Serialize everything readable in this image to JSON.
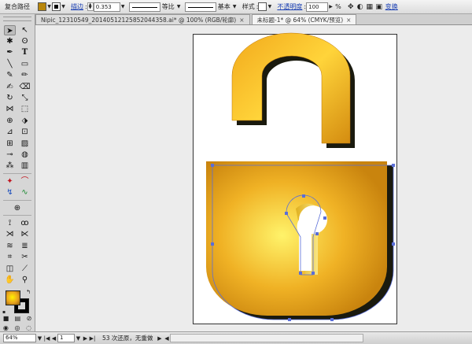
{
  "control_bar": {
    "object_type": "复合路径",
    "stroke_label": "描边",
    "stroke_weight": "0.353",
    "profile_label": "等比",
    "brush_label": "基本",
    "style_label": "样式",
    "opacity_label": "不透明度",
    "opacity_value": "100",
    "opacity_unit": "%",
    "transform_label": "变换"
  },
  "tabs": [
    {
      "label": "Nipic_12310549_20140512125852044358.ai* @ 100% (RGB/轮廓)",
      "close": "×"
    },
    {
      "label": "未标题-1* @ 64% (CMYK/预览)",
      "close": "×"
    }
  ],
  "status_bar": {
    "zoom": "64%",
    "artboard_number": "1",
    "status_text": "53 次还原，无重做"
  },
  "colors": {
    "gold_light": "#fff36a",
    "gold_mid": "#f0b225",
    "gold_dark": "#c9840e",
    "shadow": "#1a1a0e",
    "selection": "#5a6ed8"
  },
  "icons": {
    "selection": "selection-icon",
    "direct_selection": "direct-selection-icon",
    "pen": "pen-icon",
    "type": "type-icon",
    "zoom": "zoom-icon",
    "hand": "hand-icon"
  }
}
